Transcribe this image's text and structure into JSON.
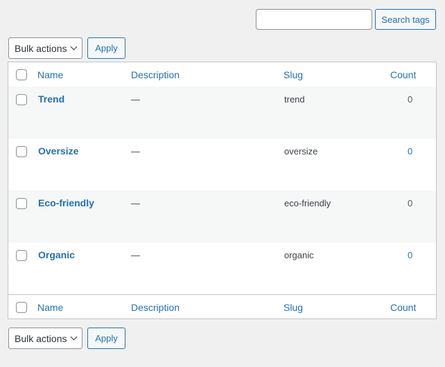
{
  "search": {
    "value": "",
    "button": "Search tags"
  },
  "bulk_top": {
    "select": "Bulk actions",
    "apply": "Apply"
  },
  "bulk_bottom": {
    "select": "Bulk actions",
    "apply": "Apply"
  },
  "columns": {
    "name": "Name",
    "description": "Description",
    "slug": "Slug",
    "count": "Count"
  },
  "rows": [
    {
      "name": "Trend",
      "description": "—",
      "slug": "trend",
      "count": "0"
    },
    {
      "name": "Oversize",
      "description": "—",
      "slug": "oversize",
      "count": "0"
    },
    {
      "name": "Eco-friendly",
      "description": "—",
      "slug": "eco-friendly",
      "count": "0"
    },
    {
      "name": "Organic",
      "description": "—",
      "slug": "organic",
      "count": "0"
    }
  ],
  "colors": {
    "link": "#2271b1",
    "border": "#c3c4c7",
    "background": "#f0f0f1"
  }
}
